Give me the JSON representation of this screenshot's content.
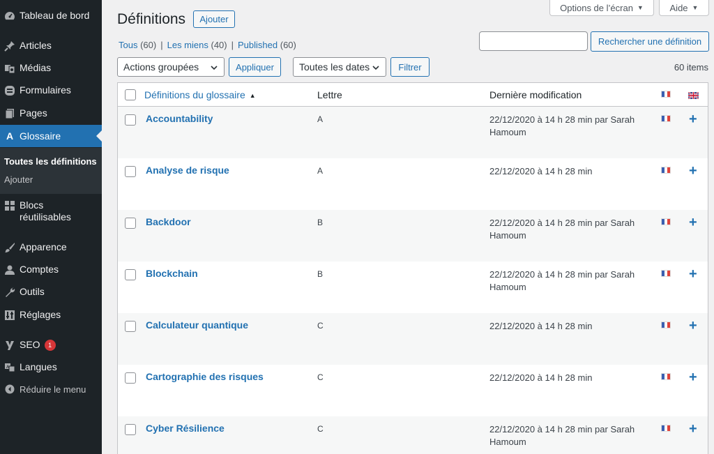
{
  "sidebar": {
    "items": [
      {
        "label": "Tableau de bord",
        "icon": "dashboard-icon"
      },
      {
        "label": "Articles",
        "icon": "pin-icon"
      },
      {
        "label": "Médias",
        "icon": "media-icon"
      },
      {
        "label": "Formulaires",
        "icon": "forms-icon"
      },
      {
        "label": "Pages",
        "icon": "pages-icon"
      },
      {
        "label": "Glossaire",
        "icon": "glossary-icon",
        "icon_glyph": "A"
      },
      {
        "label": "Blocs réutilisables",
        "icon": "blocks-icon"
      },
      {
        "label": "Apparence",
        "icon": "brush-icon"
      },
      {
        "label": "Comptes",
        "icon": "user-icon"
      },
      {
        "label": "Outils",
        "icon": "wrench-icon"
      },
      {
        "label": "Réglages",
        "icon": "settings-icon"
      },
      {
        "label": "SEO",
        "icon": "yoast-icon",
        "badge": "1"
      },
      {
        "label": "Langues",
        "icon": "translate-icon"
      }
    ],
    "submenu": [
      "Toutes les définitions",
      "Ajouter"
    ],
    "collapse_label": "Réduire le menu"
  },
  "screen_options": {
    "options_label": "Options de l’écran",
    "help_label": "Aide"
  },
  "page": {
    "title": "Définitions",
    "add_button": "Ajouter"
  },
  "views": [
    {
      "label": "Tous",
      "count": "(60)"
    },
    {
      "label": "Les miens",
      "count": "(40)"
    },
    {
      "label": "Published",
      "count": "(60)"
    }
  ],
  "search": {
    "value": "",
    "button_label": "Rechercher une définition"
  },
  "bulk": {
    "select_label": "Actions groupées",
    "apply_label": "Appliquer"
  },
  "dates": {
    "select_label": "Toutes les dates",
    "filter_label": "Filtrer"
  },
  "items_count": "60 items",
  "table": {
    "columns": [
      "Définitions du glossaire",
      "Lettre",
      "Dernière modification"
    ],
    "rows": [
      {
        "title": "Accountability",
        "letter": "A",
        "modified": "22/12/2020 à 14 h 28 min par Sarah Hamoum"
      },
      {
        "title": "Analyse de risque",
        "letter": "A",
        "modified": "22/12/2020 à 14 h 28 min"
      },
      {
        "title": "Backdoor",
        "letter": "B",
        "modified": "22/12/2020 à 14 h 28 min par Sarah Hamoum"
      },
      {
        "title": "Blockchain",
        "letter": "B",
        "modified": "22/12/2020 à 14 h 28 min par Sarah Hamoum"
      },
      {
        "title": "Calculateur quantique",
        "letter": "C",
        "modified": "22/12/2020 à 14 h 28 min"
      },
      {
        "title": "Cartographie des risques",
        "letter": "C",
        "modified": "22/12/2020 à 14 h 28 min"
      },
      {
        "title": "Cyber Résilience",
        "letter": "C",
        "modified": "22/12/2020 à 14 h 28 min par Sarah Hamoum"
      }
    ]
  },
  "colors": {
    "accent": "#2271b1",
    "sidebar": "#1d2327",
    "badge": "#d63638"
  }
}
